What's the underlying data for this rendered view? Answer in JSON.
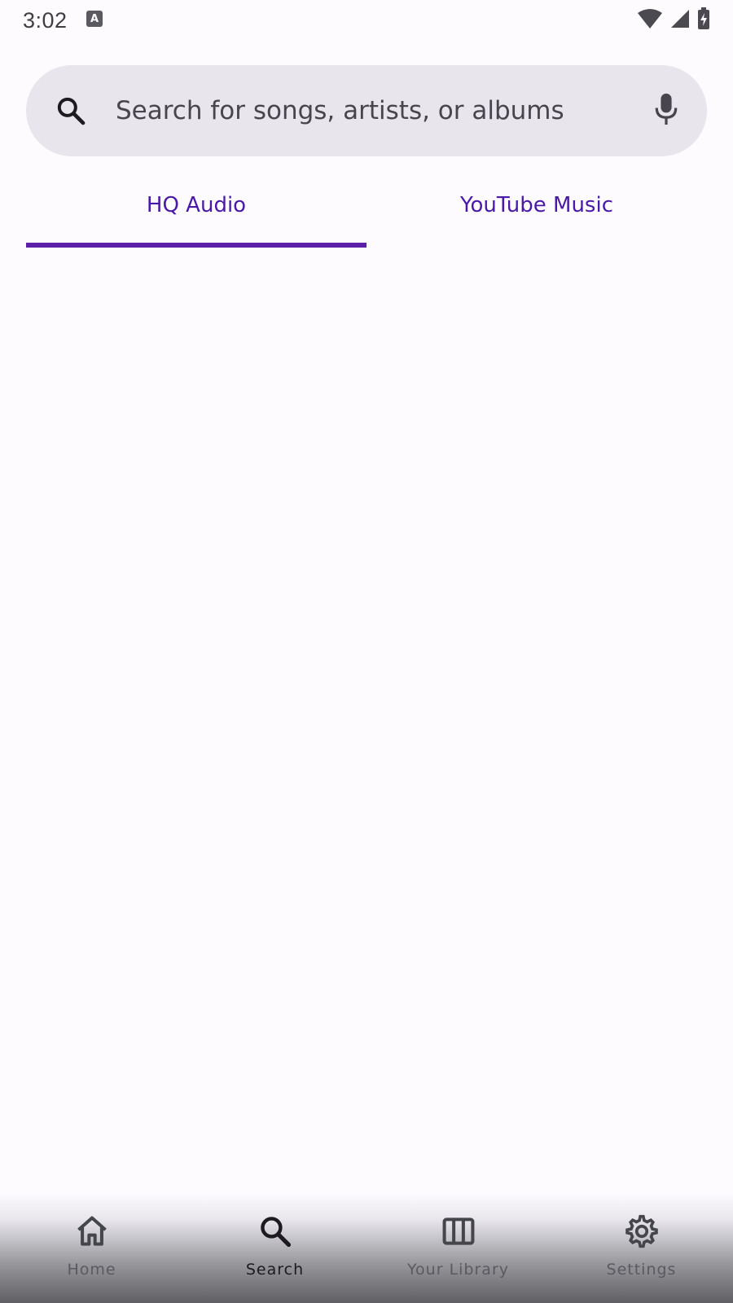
{
  "status_bar": {
    "time": "3:02",
    "icons": [
      "keyboard-a-icon",
      "wifi-icon",
      "signal-icon",
      "battery-charging-icon"
    ]
  },
  "search": {
    "placeholder": "Search for songs, artists, or albums",
    "value": "",
    "left_icon": "search-icon",
    "right_icon": "mic-icon"
  },
  "tabs": [
    {
      "label": "HQ Audio",
      "selected": true
    },
    {
      "label": "YouTube Music",
      "selected": false
    }
  ],
  "bottom_nav": {
    "items": [
      {
        "label": "Home",
        "icon": "home-icon",
        "active": false
      },
      {
        "label": "Search",
        "icon": "search-icon",
        "active": true
      },
      {
        "label": "Your Library",
        "icon": "library-icon",
        "active": false
      },
      {
        "label": "Settings",
        "icon": "gear-icon",
        "active": false
      }
    ]
  },
  "colors": {
    "accent": "#5b1fa8",
    "tab_text": "#4a1aa6",
    "background": "#fefbff",
    "search_bg": "#e8e6ec"
  }
}
